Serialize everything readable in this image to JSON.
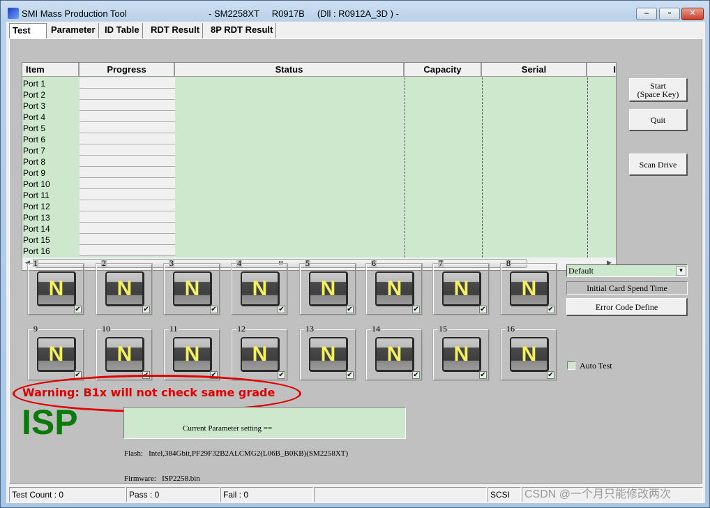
{
  "window": {
    "title": "SMI Mass Production Tool",
    "subtitle": "- SM2258XT     R0917B     (Dll : R0912A_3D ) -",
    "minimize": "–",
    "maximize": "▫",
    "close": "✕"
  },
  "tabs": [
    {
      "label": "Test",
      "active": true
    },
    {
      "label": "Parameter"
    },
    {
      "label": "ID Table"
    },
    {
      "label": "RDT Result"
    },
    {
      "label": "8P RDT Result"
    }
  ],
  "grid": {
    "columns": [
      "Item",
      "Progress",
      "Status",
      "Capacity",
      "Serial",
      "I"
    ],
    "rows": [
      "Port 1",
      "Port 2",
      "Port 3",
      "Port 4",
      "Port 5",
      "Port 6",
      "Port 7",
      "Port 8",
      "Port 9",
      "Port 10",
      "Port 11",
      "Port 12",
      "Port 13",
      "Port 14",
      "Port 15",
      "Port 16"
    ],
    "scroll_thumb": "III"
  },
  "ports": [
    {
      "num": "1",
      "letter": "N",
      "checked": true
    },
    {
      "num": "2",
      "letter": "N",
      "checked": true
    },
    {
      "num": "3",
      "letter": "N",
      "checked": true
    },
    {
      "num": "4",
      "letter": "N",
      "checked": true
    },
    {
      "num": "5",
      "letter": "N",
      "checked": true
    },
    {
      "num": "6",
      "letter": "N",
      "checked": true
    },
    {
      "num": "7",
      "letter": "N",
      "checked": true
    },
    {
      "num": "8",
      "letter": "N",
      "checked": true
    },
    {
      "num": "9",
      "letter": "N",
      "checked": true
    },
    {
      "num": "10",
      "letter": "N",
      "checked": true
    },
    {
      "num": "11",
      "letter": "N",
      "checked": true
    },
    {
      "num": "12",
      "letter": "N",
      "checked": true
    },
    {
      "num": "13",
      "letter": "N",
      "checked": true
    },
    {
      "num": "14",
      "letter": "N",
      "checked": true
    },
    {
      "num": "15",
      "letter": "N",
      "checked": true
    },
    {
      "num": "16",
      "letter": "N",
      "checked": true
    }
  ],
  "buttons": {
    "start_line1": "Start",
    "start_line2": "(Space Key)",
    "quit": "Quit",
    "scan": "Scan Drive",
    "initial_card": "Initial Card Spend Time",
    "error_code": "Error Code Define"
  },
  "dropdown": {
    "value": "Default"
  },
  "auto_test": {
    "label": "Auto Test",
    "checked": false
  },
  "warning": "Warning: B1x will not check same grade",
  "mode": "ISP",
  "param": {
    "header": "Current Parameter setting ==",
    "flash": "Flash:   Intel,384Gbit,PF29F32B2ALCMG2(L06B_B0KB)(SM2258XT)",
    "firmware": "Firmware:   ISP2258.bin"
  },
  "status": {
    "test_count": "Test Count : 0",
    "pass": "Pass : 0",
    "fail": "Fail : 0",
    "bus": "SCSI",
    "watermark": "CSDN @一个月只能修改两次"
  },
  "colors": {
    "grid_bg": "#cde8cd",
    "warning": "#e00000",
    "isp": "#0a7a0a",
    "panel": "#c0c0c0"
  }
}
